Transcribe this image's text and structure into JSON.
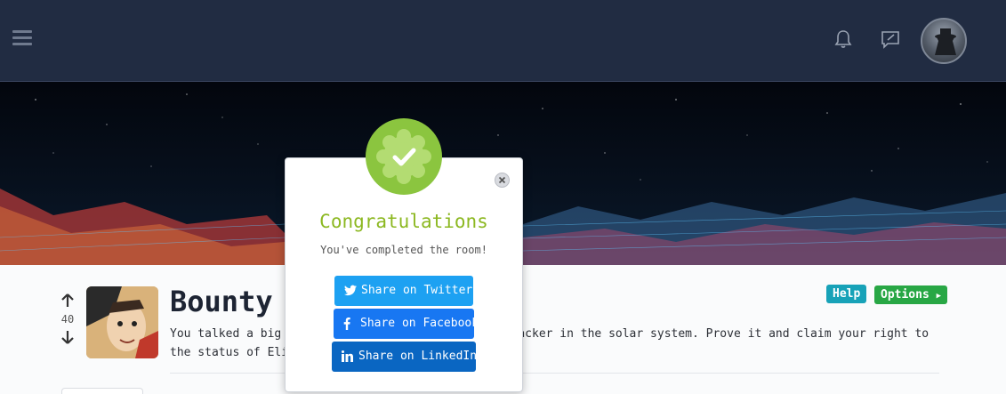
{
  "nav": {
    "menu_icon": "hamburger-icon",
    "notification_icon": "bell-icon",
    "notes_icon": "edit-note-icon",
    "avatar_icon": "user-avatar"
  },
  "room": {
    "title": "Bounty",
    "votes": "40",
    "description": "You talked a big game about being the most elite hacker in the solar system. Prove it and claim your right to the status of Elite Bounty Hacker!",
    "help_label": "Help",
    "options_label": "Options"
  },
  "modal": {
    "title": "Congratulations",
    "subtitle": "You've completed the room!",
    "share_twitter": "Share on Twitter",
    "share_facebook": "Share on Facebook",
    "share_linkedin": "Share on LinkedIn"
  },
  "colors": {
    "nav_bg": "#212c42",
    "badge_green": "#8bc53f",
    "help_teal": "#17a2b8",
    "options_green": "#28a745",
    "twitter": "#1da1f2",
    "facebook": "#1877f2",
    "linkedin": "#0a66c2"
  }
}
